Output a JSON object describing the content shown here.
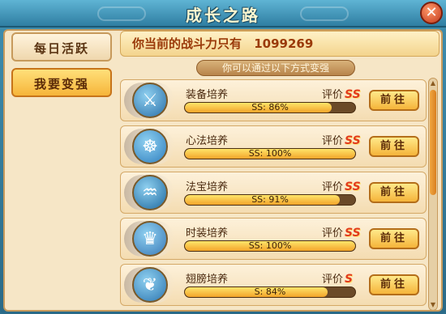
{
  "window": {
    "title": "成长之路",
    "close_label": "✕"
  },
  "tabs": [
    {
      "label": "每日活跃",
      "active": false
    },
    {
      "label": "我要变强",
      "active": true
    }
  ],
  "banner": {
    "text": "你当前的战斗力只有",
    "power": "1099269"
  },
  "subtitle": "你可以通过以下方式变强",
  "rating_label": "评价",
  "go_label": "前往",
  "rows": [
    {
      "name": "装备培养",
      "grade": "SS",
      "progress_text": "SS: 86%",
      "progress": 0.86,
      "icon": "sword-icon",
      "icon_color": "#2a6fa8",
      "glyph": "⚔"
    },
    {
      "name": "心法培养",
      "grade": "SS",
      "progress_text": "SS: 100%",
      "progress": 1.0,
      "icon": "monk-icon",
      "icon_color": "#2f7fbf",
      "glyph": "☸"
    },
    {
      "name": "法宝培养",
      "grade": "SS",
      "progress_text": "SS: 91%",
      "progress": 0.91,
      "icon": "gourd-icon",
      "icon_color": "#1f6aa0",
      "glyph": "♒"
    },
    {
      "name": "时装培养",
      "grade": "SS",
      "progress_text": "SS: 100%",
      "progress": 1.0,
      "icon": "costume-icon",
      "icon_color": "#3a7ab8",
      "glyph": "♛"
    },
    {
      "name": "翅膀培养",
      "grade": "S",
      "progress_text": "S: 84%",
      "progress": 0.84,
      "icon": "wing-icon",
      "icon_color": "#2d76b0",
      "glyph": "❦"
    }
  ]
}
